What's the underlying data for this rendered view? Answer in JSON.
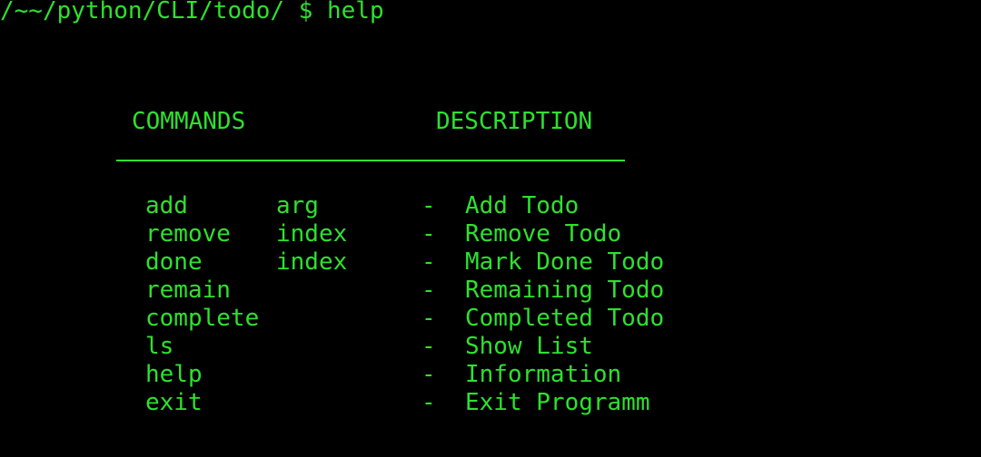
{
  "terminal": {
    "prompt": "/~~/python/CLI/todo/ $ help",
    "text_color": "#2ee12e",
    "background_color": "#000000"
  },
  "help_table": {
    "headers": {
      "commands": "COMMANDS",
      "description": "DESCRIPTION"
    },
    "separator": "-",
    "rows": [
      {
        "command": "add",
        "arg": "arg",
        "description": "Add Todo"
      },
      {
        "command": "remove",
        "arg": "index",
        "description": "Remove Todo"
      },
      {
        "command": "done",
        "arg": "index",
        "description": "Mark Done Todo"
      },
      {
        "command": "remain",
        "arg": "",
        "description": "Remaining Todo"
      },
      {
        "command": "complete",
        "arg": "",
        "description": "Completed Todo"
      },
      {
        "command": "ls",
        "arg": "",
        "description": "Show List"
      },
      {
        "command": "help",
        "arg": "",
        "description": "Information"
      },
      {
        "command": "exit",
        "arg": "",
        "description": "Exit Programm"
      }
    ]
  }
}
